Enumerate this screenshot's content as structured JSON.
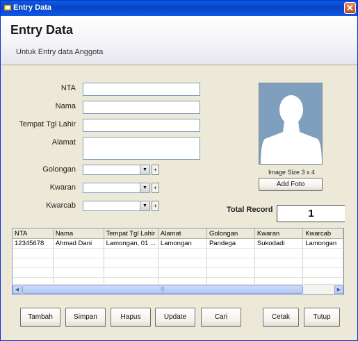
{
  "window": {
    "title": "Entry Data",
    "close_label": "✕"
  },
  "header": {
    "title": "Entry Data",
    "subtitle": "Untuk Entry data Anggota"
  },
  "form": {
    "nta_label": "NTA",
    "nama_label": "Nama",
    "ttl_label": "Tempat Tgl Lahir",
    "alamat_label": "Alamat",
    "golongan_label": "Golongan",
    "kwaran_label": "Kwaran",
    "kwarcab_label": "Kwarcab",
    "nta_value": "",
    "nama_value": "",
    "ttl_value": "",
    "alamat_value": "",
    "golongan_value": "",
    "kwaran_value": "",
    "kwarcab_value": "",
    "plus_label": "+"
  },
  "photo": {
    "caption": "Image Size 3 x 4",
    "add_button": "Add Foto"
  },
  "total": {
    "label": "Total Record",
    "value": "1"
  },
  "grid": {
    "columns": [
      "NTA",
      "Nama",
      "Tempat Tgl Lahir",
      "Alamat",
      "Golongan",
      "Kwaran",
      "Kwarcab"
    ],
    "rows": [
      [
        "12345678",
        "Ahmad Dani",
        "Lamongan, 01 ...",
        "Lamongan",
        "Pandega",
        "Sukodadi",
        "Lamongan"
      ]
    ]
  },
  "buttons": {
    "tambah": "Tambah",
    "simpan": "Simpan",
    "hapus": "Hapus",
    "update": "Update",
    "cari": "Cari",
    "cetak": "Cetak",
    "tutup": "Tutup"
  }
}
